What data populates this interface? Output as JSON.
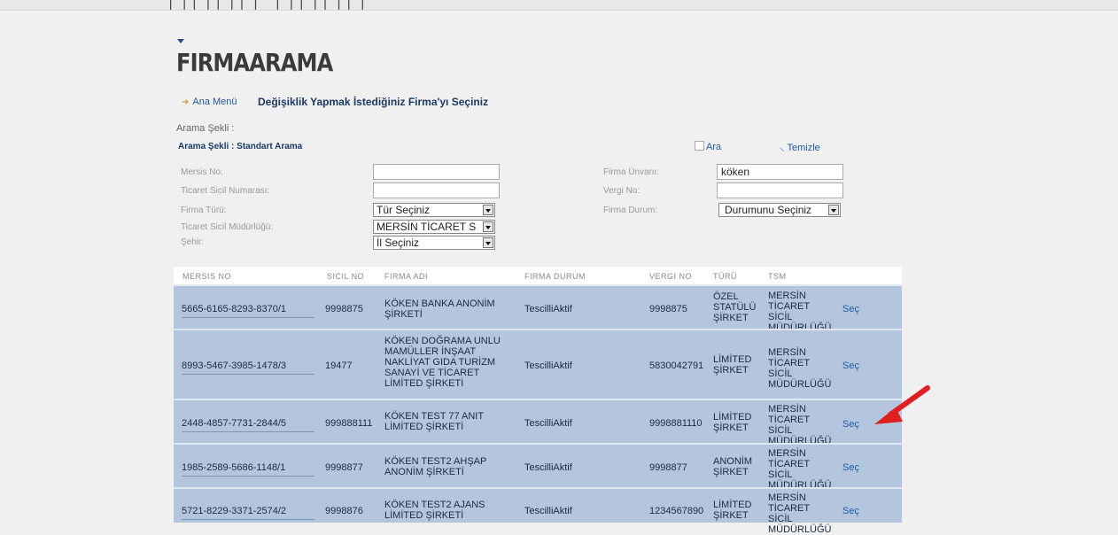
{
  "page": {
    "title": "FIRMAARAMA",
    "nav_link": "Ana Menü",
    "heading": "Değişiklik Yapmak İstediğiniz Firma'yı Seçiniz",
    "search_label": "Arama Şekli :",
    "search_mode": "Arama Şekli : Standart Arama",
    "ara_label": "Ara",
    "temizle_label": "Temizle"
  },
  "form": {
    "mersis_label": "Mersis No:",
    "mersis_value": "",
    "sicil_label": "Ticaret Sicil Numarası:",
    "sicil_value": "",
    "firma_turu_label": "Firma Türü:",
    "firma_turu_value": "Tür Seçiniz",
    "mudurluk_label": "Ticaret Sicil Müdürlüğü:",
    "mudurluk_value": "MERSİN TİCARET S",
    "sehir_label": "Şehir:",
    "sehir_value": "İl Seçiniz",
    "unvan_label": "Firma Ünvanı:",
    "unvan_value": "köken",
    "vergi_label": "Vergi No:",
    "vergi_value": "",
    "durum_label": "Firma Durum:",
    "durum_value": "Durumunu Seçiniz"
  },
  "table": {
    "headers": [
      "MERSIS NO",
      "SICIL NO",
      "FIRMA ADI",
      "FIRMA DURUM",
      "VERGI NO",
      "TÜRÜ",
      "TSM"
    ],
    "rows": [
      {
        "mersis": "5665-6165-8293-8370/1",
        "sicil": "9998875",
        "firma": "KÖKEN BANKA ANONİM ŞİRKETİ",
        "durum": "TescilliAktif",
        "vergi": "9998875",
        "turu": "ÖZEL STATÜLÜ ŞİRKET",
        "tsm": "MERSİN TİCARET SİCİL MÜDÜRLÜĞÜ",
        "action": "Seç"
      },
      {
        "mersis": "8993-5467-3985-1478/3",
        "sicil": "19477",
        "firma": "KÖKEN DOĞRAMA UNLU MAMÜLLER İNŞAAT NAKLİYAT GIDA TURİZM SANAYİ VE TİCARET LİMİTED ŞİRKETİ",
        "durum": "TescilliAktif",
        "vergi": "5830042791",
        "turu": "LİMİTED ŞİRKET",
        "tsm": "MERSİN TİCARET SİCİL MÜDÜRLÜĞÜ",
        "action": "Seç"
      },
      {
        "mersis": "2448-4857-7731-2844/5",
        "sicil": "999888111",
        "firma": "KÖKEN TEST 77 ANIT LİMİTED ŞİRKETİ",
        "durum": "TescilliAktif",
        "vergi": "9998881110",
        "turu": "LİMİTED ŞİRKET",
        "tsm": "MERSİN TİCARET SİCİL MÜDÜRLÜĞÜ",
        "action": "Seç"
      },
      {
        "mersis": "1985-2589-5686-1148/1",
        "sicil": "9998877",
        "firma": "KÖKEN TEST2 AHŞAP ANONİM ŞİRKETİ",
        "durum": "TescilliAktif",
        "vergi": "9998877",
        "turu": "ANONİM ŞİRKET",
        "tsm": "MERSİN TİCARET SİCİL MÜDÜRLÜĞÜ",
        "action": "Seç"
      },
      {
        "mersis": "5721-8229-3371-2574/2",
        "sicil": "9998876",
        "firma": "KÖKEN TEST2 AJANS LİMİTED ŞİRKETİ",
        "durum": "TescilliAktif",
        "vergi": "1234567890",
        "turu": "LİMİTED ŞİRKET",
        "tsm": "MERSİN TİCARET SİCİL MÜDÜRLÜĞÜ",
        "action": "Seç"
      }
    ]
  },
  "colors": {
    "row_bg": "#b4c6de",
    "link": "#1f5aa6",
    "arrow": "#e02020"
  }
}
